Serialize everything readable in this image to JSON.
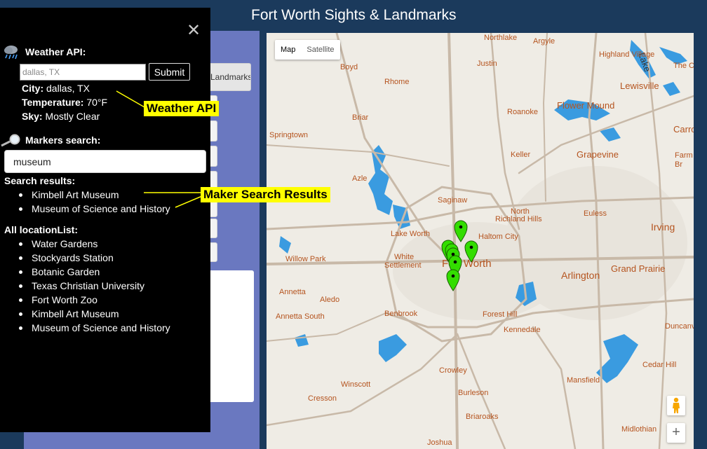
{
  "header": {
    "title": "Fort Worth Sights & Landmarks"
  },
  "background": {
    "button_label": "Landmarks"
  },
  "drawer": {
    "weather": {
      "title": "Weather API:",
      "icon": "rain-cloud-icon",
      "input_placeholder": "dallas, TX",
      "input_value": "",
      "submit_label": "Submit",
      "city_label": "City:",
      "city_value": "dallas, TX",
      "temperature_label": "Temperature:",
      "temperature_value": "70°F",
      "sky_label": "Sky:",
      "sky_value": "Mostly Clear"
    },
    "markers": {
      "title": "Markers search:",
      "icon": "magnifier-icon",
      "input_value": "museum"
    },
    "search_results": {
      "title": "Search results:",
      "items": [
        "Kimbell Art Museum",
        "Museum of Science and History"
      ]
    },
    "all_locations": {
      "title": "All locationList:",
      "items": [
        "Water Gardens",
        "Stockyards Station",
        "Botanic Garden",
        "Texas Christian University",
        "Fort Worth Zoo",
        "Kimbell Art Museum",
        "Museum of Science and History"
      ]
    }
  },
  "map": {
    "type_controls": [
      "Map",
      "Satellite"
    ],
    "active_type": "Map",
    "zoom_in_label": "+",
    "marker_color": "#33dd00",
    "water_color": "#3a9be0",
    "road_color": "#c8b9a8",
    "place_labels": {
      "northlake": "Northlake",
      "argyle": "Argyle",
      "lake": "Lake",
      "highland_village": "Highland Village",
      "the_colony": "The C",
      "boyd": "Boyd",
      "justin": "Justin",
      "lewisville": "Lewisville",
      "rhome": "Rhome",
      "flower_mound": "Flower Mound",
      "roanoke": "Roanoke",
      "briar": "Briar",
      "carrollton": "Carro",
      "springtown": "Springtown",
      "keller": "Keller",
      "grapevine": "Grapevine",
      "farmers": "Farm",
      "branch": "Br",
      "azle": "Azle",
      "saginaw": "Saginaw",
      "north": "North",
      "richland_hills": "Richland Hills",
      "euless": "Euless",
      "lake_worth": "Lake Worth",
      "haltom_city": "Haltom City",
      "irving": "Irving",
      "white": "White",
      "settlement": "Settlement",
      "fort_worth": "Fort Worth",
      "willow_park": "Willow Park",
      "grand_prairie": "Grand Prairie",
      "arlington": "Arlington",
      "annetta": "Annetta",
      "aledo": "Aledo",
      "benbrook": "Benbrook",
      "annetta_south": "Annetta South",
      "forest_hill": "Forest Hill",
      "kennedale": "Kennedale",
      "duncanville": "Duncanv",
      "cedar_hill": "Cedar Hill",
      "crowley": "Crowley",
      "mansfield": "Mansfield",
      "winscott": "Winscott",
      "burleson": "Burleson",
      "cresson": "Cresson",
      "briaroaks": "Briaroaks",
      "midlothian": "Midlothian",
      "joshua": "Joshua"
    }
  },
  "annotations": {
    "weather_api": "Weather API",
    "marker_search_results": "Maker Search Results"
  }
}
